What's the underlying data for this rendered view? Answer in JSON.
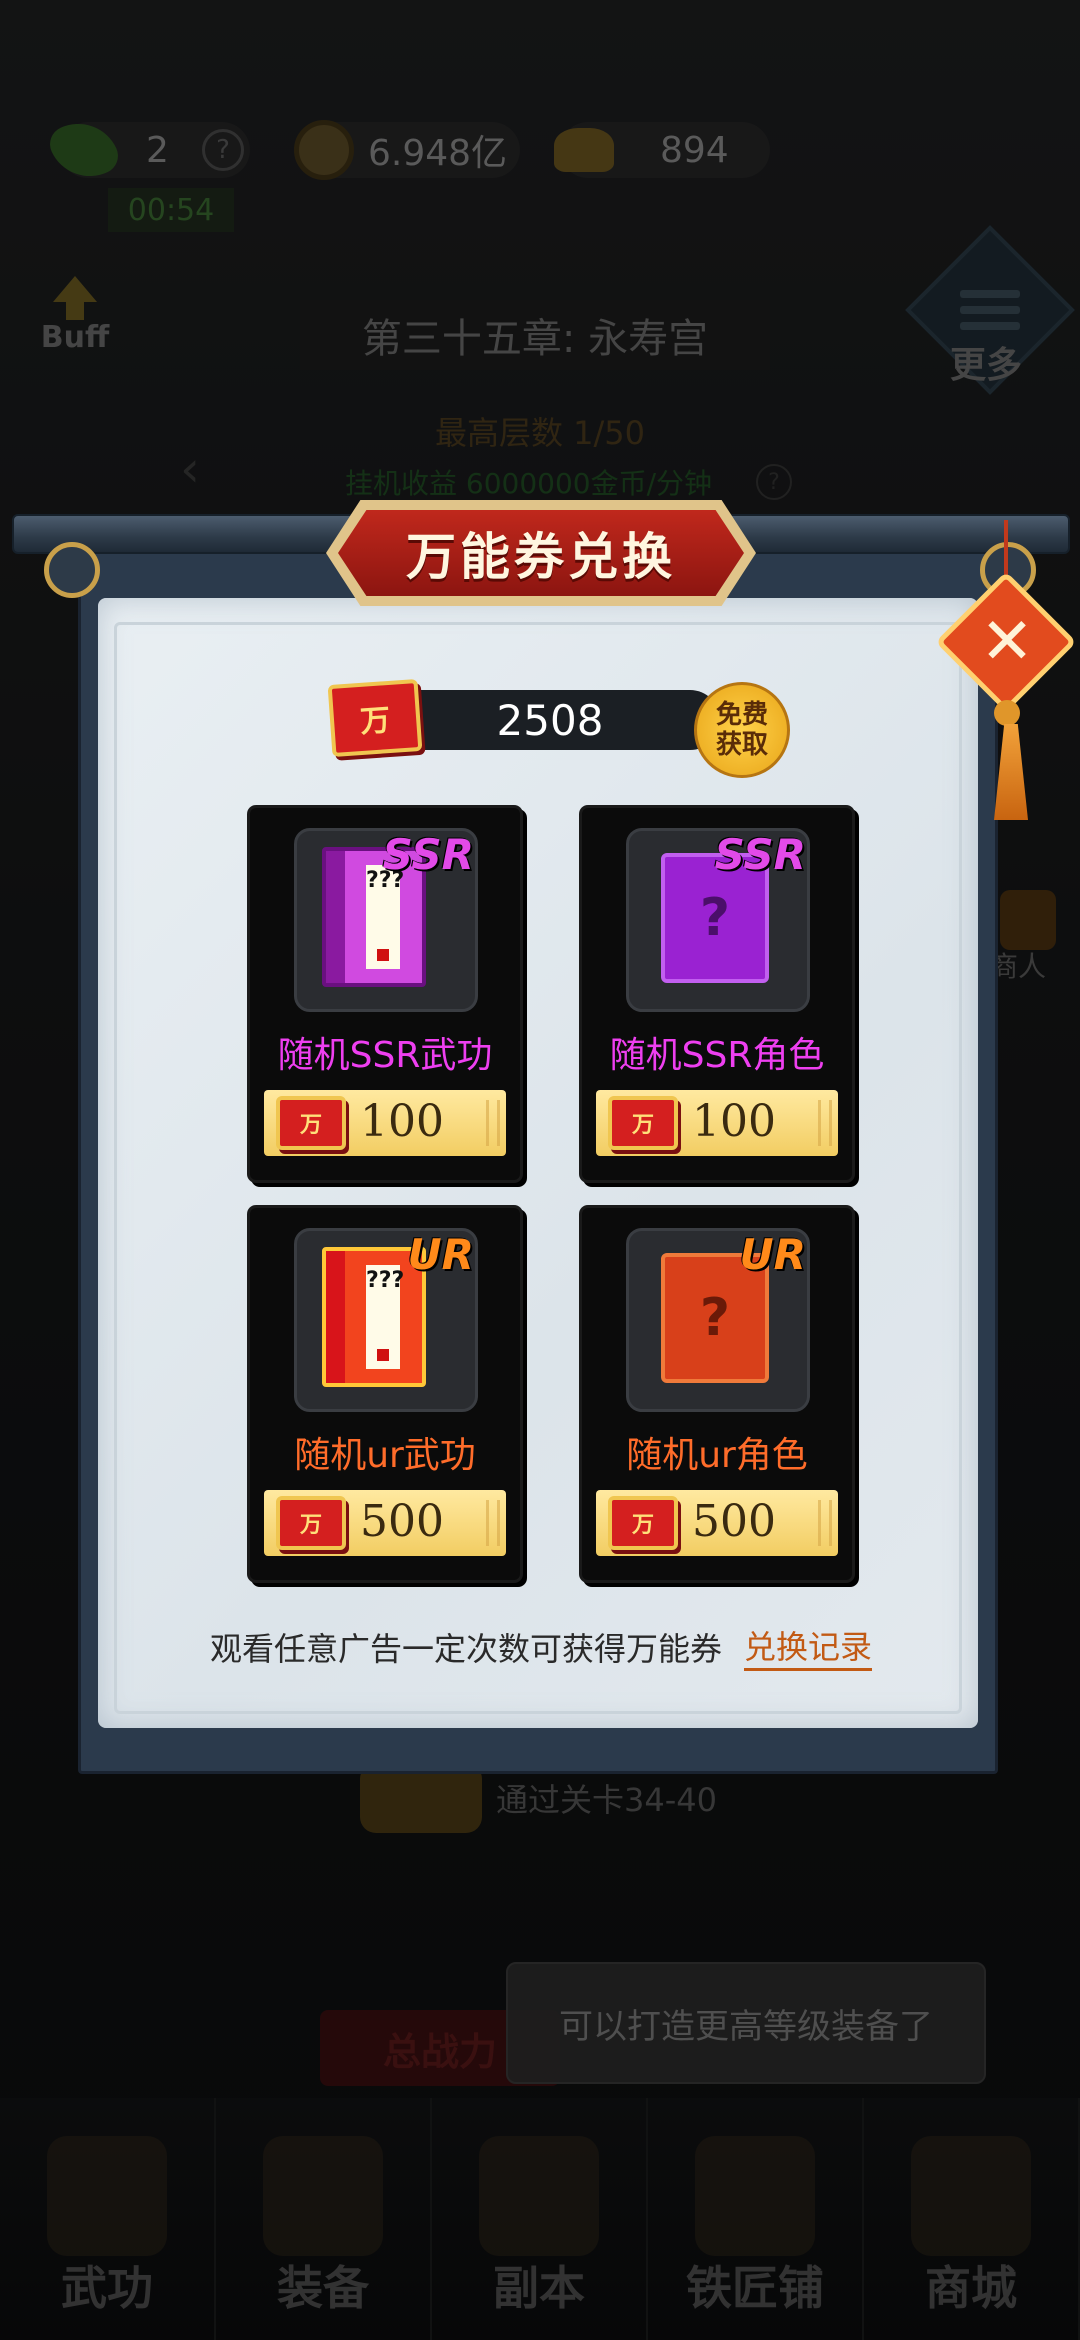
{
  "background": {
    "energy": {
      "value": "2",
      "help": "?",
      "timer": "00:54"
    },
    "coins": "6.948亿",
    "ingots": "894",
    "buff_label": "Buff",
    "chapter_title": "第三十五章: 永寿宫",
    "more_label": "更多",
    "max_floor": "最高层数 1/50",
    "idle_income": "挂机收益 6000000金币/分钟",
    "idle_help": "?",
    "merchant_label": "商人",
    "pass_reward": "通过关卡34-40",
    "power_label": "总战力",
    "toast": "可以打造更高等级装备了",
    "tabs": [
      {
        "label": "武功"
      },
      {
        "label": "装备"
      },
      {
        "label": "副本"
      },
      {
        "label": "铁匠铺"
      },
      {
        "label": "商城"
      }
    ]
  },
  "modal": {
    "title": "万能券兑换",
    "close_symbol": "✕",
    "ticket_glyph": "万",
    "balance": "2508",
    "free_button": {
      "line1": "免费",
      "line2": "获取"
    },
    "items": [
      {
        "tag": "SSR",
        "name": "随机SSR武功",
        "price": "100",
        "book_text": "???",
        "tier": "ssr",
        "kind": "book"
      },
      {
        "tag": "SSR",
        "name": "随机SSR角色",
        "price": "100",
        "role_text": "?",
        "tier": "ssr",
        "kind": "role"
      },
      {
        "tag": "UR",
        "name": "随机ur武功",
        "price": "500",
        "book_text": "???",
        "tier": "ur",
        "kind": "book"
      },
      {
        "tag": "UR",
        "name": "随机ur角色",
        "price": "500",
        "role_text": "?",
        "tier": "ur",
        "kind": "role"
      }
    ],
    "footnote": "观看任意广告一定次数可获得万能券",
    "record_link": "兑换记录"
  },
  "colors": {
    "ssr": "#ee3ff0",
    "ur": "#ff6c2a",
    "title_red": "#c0281c",
    "gold": "#f2cd62"
  }
}
